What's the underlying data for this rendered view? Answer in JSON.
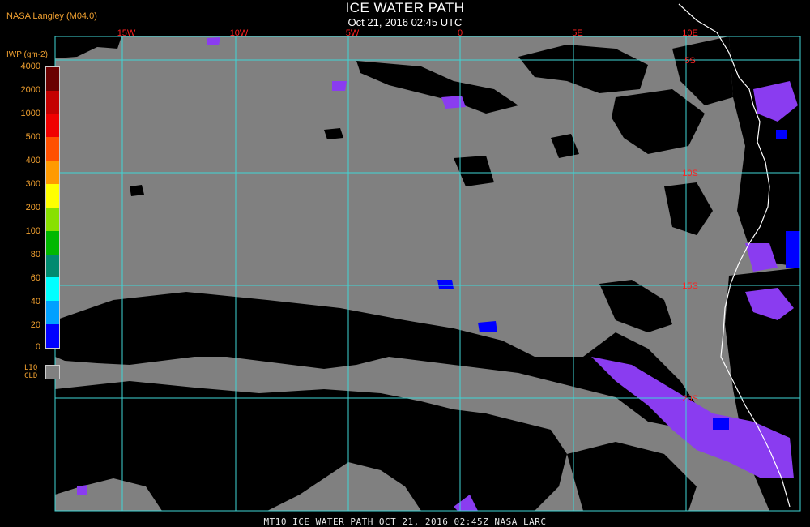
{
  "header": {
    "credit": "NASA Langley (M04.0)",
    "title": "ICE WATER PATH",
    "subtitle": "Oct 21, 2016 02:45 UTC"
  },
  "legend": {
    "unit": "IWP (gm-2)",
    "ticks": [
      "4000",
      "2000",
      "1000",
      "500",
      "400",
      "300",
      "200",
      "100",
      "80",
      "60",
      "40",
      "20",
      "0"
    ],
    "colors": [
      "#6a0000",
      "#c40000",
      "#f00000",
      "#ff5000",
      "#ff9a00",
      "#ffff00",
      "#88e000",
      "#00b800",
      "#008a70",
      "#00ffff",
      "#00a0ff",
      "#0000ff",
      "#9030ff"
    ],
    "liquid_label_1": "LIQ",
    "liquid_label_2": "CLD",
    "liquid_color": "#808080"
  },
  "map": {
    "lon_labels": [
      "15W",
      "10W",
      "5W",
      "0",
      "5E",
      "10E"
    ],
    "lat_labels": [
      "5S",
      "10S",
      "15S",
      "20S"
    ],
    "grid_color": "#3fd6d6",
    "ocean_cloud_color": "#808080",
    "clear_color": "#000000",
    "ice_color": "#8a3cf0",
    "coast_color": "#ffffff"
  },
  "footer": {
    "text": "MT10  ICE WATER PATH   OCT 21, 2016 02:45Z   NASA LARC"
  }
}
